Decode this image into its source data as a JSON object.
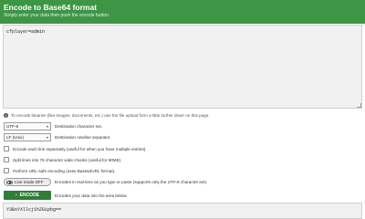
{
  "header": {
    "title": "Encode to Base64 format",
    "subtitle": "Simply enter your data then push the encode button."
  },
  "input": {
    "value": "cfplayer=admin"
  },
  "info": {
    "icon": "info-icon",
    "text": "To encode binaries (like images, documents, etc.) use the file upload form a little further down on this page."
  },
  "options": {
    "charset": {
      "selected": "UTF-8",
      "label": "Destination character set."
    },
    "newline": {
      "selected": "LF (Unix)",
      "label": "Destination newline separator."
    },
    "checkboxes": [
      {
        "label": "Encode each line separately (useful for when you have multiple entries).",
        "checked": false
      },
      {
        "label": "Split lines into 76 character wide chunks (useful for MIME).",
        "checked": false
      },
      {
        "label": "Perform URL-safe encoding (uses Base64URL format).",
        "checked": false
      }
    ],
    "live_mode": {
      "label": "Live mode OFF",
      "description": "Encodes in real-time as you type or paste (supports only the UTF-8 character set)."
    }
  },
  "encode": {
    "button_label": "ENCODE",
    "description": "Encodes your data into the area below."
  },
  "output": {
    "value": "Y3BsYXllcj1hZG1pbg=="
  },
  "colors": {
    "header_green": "#3d9645",
    "button_green": "#2f7d36"
  }
}
